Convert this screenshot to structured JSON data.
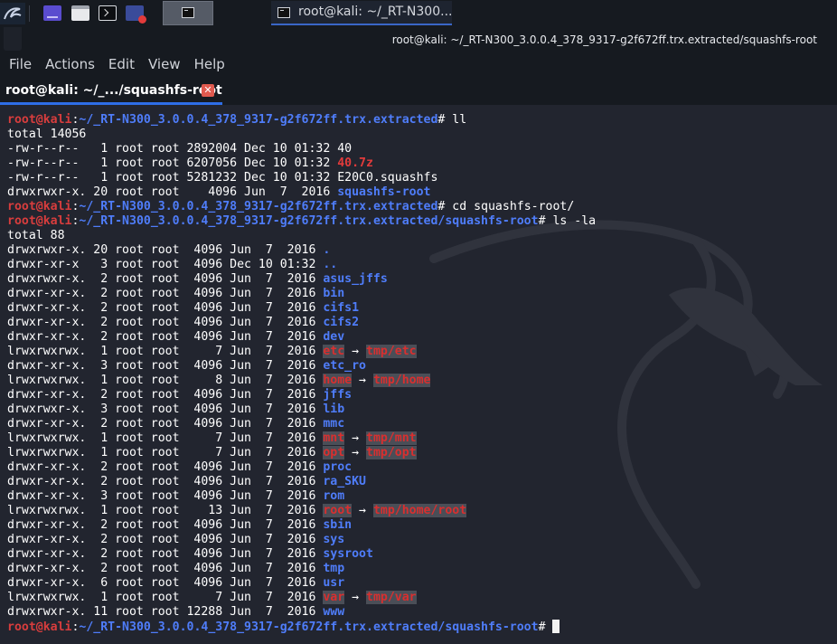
{
  "panel": {
    "launchers": [
      "kali-menu-icon",
      "workspace-icon",
      "file-manager-icon",
      "terminal-icon",
      "screen-recorder-icon"
    ],
    "active_task_icon": "terminal-icon",
    "window_button_label": "root@kali: ~/_RT-N300..."
  },
  "window": {
    "title": "root@kali: ~/_RT-N300_3.0.0.4_378_9317-g2f672ff.trx.extracted/squashfs-root"
  },
  "menubar": {
    "items": [
      "File",
      "Actions",
      "Edit",
      "View",
      "Help"
    ]
  },
  "tab": {
    "label": "root@kali: ~/_.../squashfs-root",
    "close_icon": "close-icon"
  },
  "prompt": {
    "user_host": "root@kali",
    "separator": ":"
  },
  "terminal_lines": [
    {
      "type": "prompt",
      "path": "~/_RT-N300_3.0.0.4_378_9317-g2f672ff.trx.extracted",
      "cmd": " ll"
    },
    {
      "type": "plain",
      "text": "total 14056"
    },
    {
      "type": "entry",
      "meta": "-rw-r--r--   1 root root 2892004 Dec 10 01:32 ",
      "name": "40",
      "style": "plain"
    },
    {
      "type": "entry",
      "meta": "-rw-r--r--   1 root root 6207056 Dec 10 01:32 ",
      "name": "40.7z",
      "style": "archive"
    },
    {
      "type": "entry",
      "meta": "-rw-r--r--   1 root root 5281232 Dec 10 01:32 ",
      "name": "E20C0.squashfs",
      "style": "plain"
    },
    {
      "type": "entry",
      "meta": "drwxrwxr-x. 20 root root    4096 Jun  7  2016 ",
      "name": "squashfs-root",
      "style": "dir"
    },
    {
      "type": "prompt",
      "path": "~/_RT-N300_3.0.0.4_378_9317-g2f672ff.trx.extracted",
      "cmd": " cd squashfs-root/"
    },
    {
      "type": "prompt",
      "path": "~/_RT-N300_3.0.0.4_378_9317-g2f672ff.trx.extracted/squashfs-root",
      "cmd": " ls -la"
    },
    {
      "type": "plain",
      "text": "total 88"
    },
    {
      "type": "entry",
      "meta": "drwxrwxr-x. 20 root root  4096 Jun  7  2016 ",
      "name": ".",
      "style": "dir"
    },
    {
      "type": "entry",
      "meta": "drwxr-xr-x   3 root root  4096 Dec 10 01:32 ",
      "name": "..",
      "style": "dir"
    },
    {
      "type": "entry",
      "meta": "drwxrwxr-x.  2 root root  4096 Jun  7  2016 ",
      "name": "asus_jffs",
      "style": "dir"
    },
    {
      "type": "entry",
      "meta": "drwxr-xr-x.  2 root root  4096 Jun  7  2016 ",
      "name": "bin",
      "style": "dir"
    },
    {
      "type": "entry",
      "meta": "drwxr-xr-x.  2 root root  4096 Jun  7  2016 ",
      "name": "cifs1",
      "style": "dir"
    },
    {
      "type": "entry",
      "meta": "drwxr-xr-x.  2 root root  4096 Jun  7  2016 ",
      "name": "cifs2",
      "style": "dir"
    },
    {
      "type": "entry",
      "meta": "drwxr-xr-x.  2 root root  4096 Jun  7  2016 ",
      "name": "dev",
      "style": "dir"
    },
    {
      "type": "link",
      "meta": "lrwxrwxrwx.  1 root root     7 Jun  7  2016 ",
      "name": "etc",
      "arrow": " → ",
      "target": "tmp/etc"
    },
    {
      "type": "entry",
      "meta": "drwxr-xr-x.  3 root root  4096 Jun  7  2016 ",
      "name": "etc_ro",
      "style": "dir"
    },
    {
      "type": "link",
      "meta": "lrwxrwxrwx.  1 root root     8 Jun  7  2016 ",
      "name": "home",
      "arrow": " → ",
      "target": "tmp/home"
    },
    {
      "type": "entry",
      "meta": "drwxr-xr-x.  2 root root  4096 Jun  7  2016 ",
      "name": "jffs",
      "style": "dir"
    },
    {
      "type": "entry",
      "meta": "drwxrwxr-x.  3 root root  4096 Jun  7  2016 ",
      "name": "lib",
      "style": "dir"
    },
    {
      "type": "entry",
      "meta": "drwxr-xr-x.  2 root root  4096 Jun  7  2016 ",
      "name": "mmc",
      "style": "dir"
    },
    {
      "type": "link",
      "meta": "lrwxrwxrwx.  1 root root     7 Jun  7  2016 ",
      "name": "mnt",
      "arrow": " → ",
      "target": "tmp/mnt"
    },
    {
      "type": "link",
      "meta": "lrwxrwxrwx.  1 root root     7 Jun  7  2016 ",
      "name": "opt",
      "arrow": " → ",
      "target": "tmp/opt"
    },
    {
      "type": "entry",
      "meta": "drwxr-xr-x.  2 root root  4096 Jun  7  2016 ",
      "name": "proc",
      "style": "dir"
    },
    {
      "type": "entry",
      "meta": "drwxr-xr-x.  2 root root  4096 Jun  7  2016 ",
      "name": "ra_SKU",
      "style": "dir"
    },
    {
      "type": "entry",
      "meta": "drwxr-xr-x.  3 root root  4096 Jun  7  2016 ",
      "name": "rom",
      "style": "dir"
    },
    {
      "type": "link",
      "meta": "lrwxrwxrwx.  1 root root    13 Jun  7  2016 ",
      "name": "root",
      "arrow": " → ",
      "target": "tmp/home/root"
    },
    {
      "type": "entry",
      "meta": "drwxr-xr-x.  2 root root  4096 Jun  7  2016 ",
      "name": "sbin",
      "style": "dir"
    },
    {
      "type": "entry",
      "meta": "drwxr-xr-x.  2 root root  4096 Jun  7  2016 ",
      "name": "sys",
      "style": "dir"
    },
    {
      "type": "entry",
      "meta": "drwxr-xr-x.  2 root root  4096 Jun  7  2016 ",
      "name": "sysroot",
      "style": "dir"
    },
    {
      "type": "entry",
      "meta": "drwxr-xr-x.  2 root root  4096 Jun  7  2016 ",
      "name": "tmp",
      "style": "dir"
    },
    {
      "type": "entry",
      "meta": "drwxr-xr-x.  6 root root  4096 Jun  7  2016 ",
      "name": "usr",
      "style": "dir"
    },
    {
      "type": "link",
      "meta": "lrwxrwxrwx.  1 root root     7 Jun  7  2016 ",
      "name": "var",
      "arrow": " → ",
      "target": "tmp/var"
    },
    {
      "type": "entry",
      "meta": "drwxrwxr-x. 11 root root 12288 Jun  7  2016 ",
      "name": "www",
      "style": "dir"
    },
    {
      "type": "prompt",
      "path": "~/_RT-N300_3.0.0.4_378_9317-g2f672ff.trx.extracted/squashfs-root",
      "cmd": " ",
      "cursor": true
    }
  ]
}
